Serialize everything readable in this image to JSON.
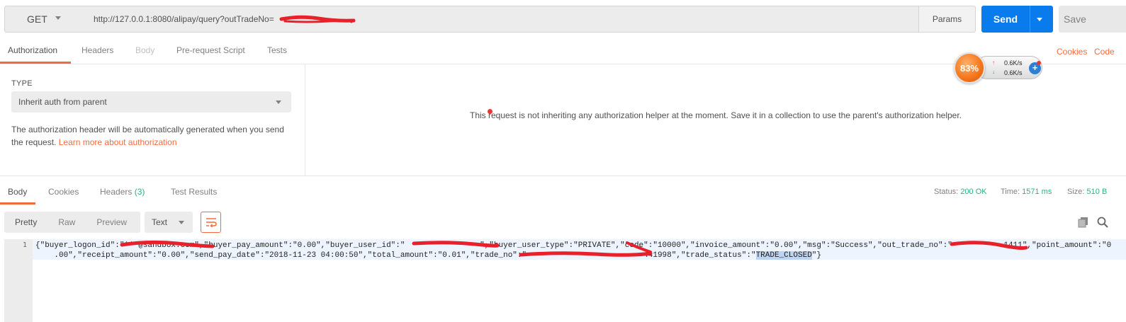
{
  "request": {
    "method": "GET",
    "url": "http://127.0.0.1:8080/alipay/query?outTradeNo=",
    "params_label": "Params",
    "send_label": "Send",
    "save_label": "Save"
  },
  "request_tabs": {
    "authorization": "Authorization",
    "headers": "Headers",
    "body": "Body",
    "prerequest": "Pre-request Script",
    "tests": "Tests",
    "cookies": "Cookies",
    "code": "Code"
  },
  "auth": {
    "type_label": "TYPE",
    "type_value": "Inherit auth from parent",
    "desc": "The authorization header will be automatically generated when you send the request. ",
    "learn_more": "Learn more about authorization",
    "message": "This request is not inheriting any authorization helper at the moment. Save it in a collection to use the parent's authorization helper."
  },
  "speed_widget": {
    "percent": "83%",
    "up_rate": "0.6K/s",
    "down_rate": "0.6K/s"
  },
  "response_tabs": {
    "body": "Body",
    "cookies": "Cookies",
    "headers": "Headers",
    "headers_count": "(3)",
    "test_results": "Test Results"
  },
  "status": {
    "status_label": "Status:",
    "status_value": "200 OK",
    "time_label": "Time:",
    "time_value": "1571 ms",
    "size_label": "Size:",
    "size_value": "510 B"
  },
  "toolbar": {
    "pretty": "Pretty",
    "raw": "Raw",
    "preview": "Preview",
    "format": "Text"
  },
  "response": {
    "line_number": "1",
    "line1_pre": "{\"buyer_logon_id\":\"***@sandbox.com\",\"buyer_pay_amount\":\"0.00\",\"buyer_user_id\":\"                \",\"buyer_user_type\":\"PRIVATE\",\"code\":\"10000\",\"invoice_amount\":\"0.00\",\"msg\":\"Success\",\"out_trade_no\":\"           1411\",\"point_amount\":\"0",
    "line2_pre": "    .00\",\"receipt_amount\":\"0.00\",\"send_pay_date\":\"2018-11-23 04:00:50\",\"total_amount\":\"0.01\",\"trade_no\":\"                         441998\",\"trade_status\":\"",
    "line2_sel": "TRADE_CLOSED",
    "line2_post": "\"}"
  }
}
